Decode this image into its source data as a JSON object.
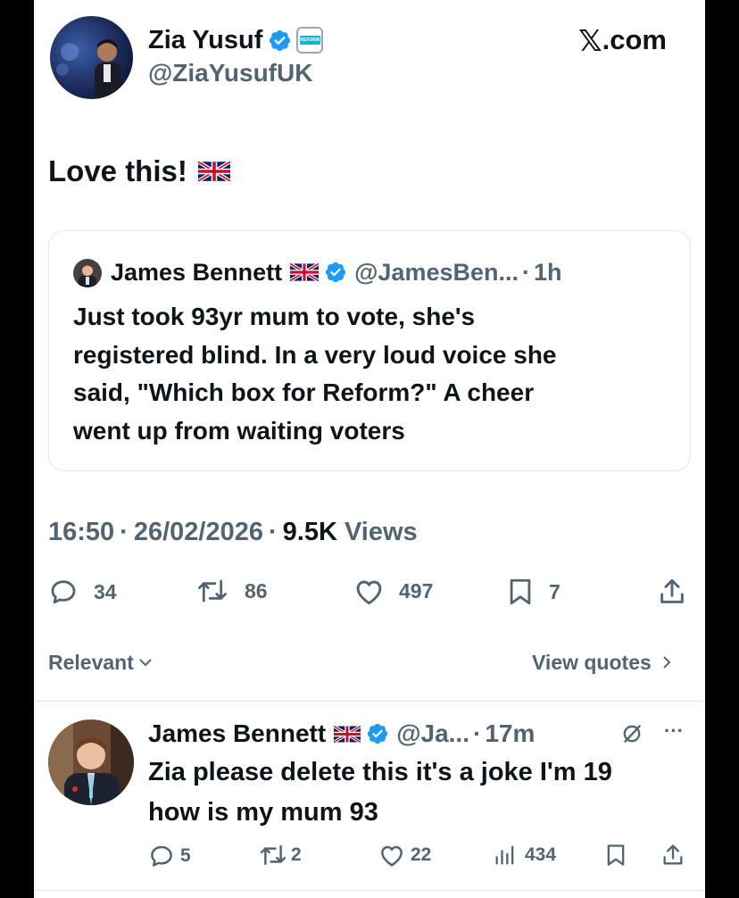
{
  "header": {
    "author_name": "Zia Yusuf",
    "author_handle": "@ZiaYusufUK",
    "affiliation_badge_text": "REFORM",
    "site_label": "X.com"
  },
  "tweet": {
    "text": "Love this!",
    "flag_icon": "uk-flag-icon"
  },
  "quoted_tweet": {
    "author_name": "James Bennett",
    "author_handle": "@JamesBen...",
    "separator": "·",
    "time": "1h",
    "text_lines": [
      "Just took 93yr mum to vote, she's",
      "registered blind. In a very loud voice she",
      "said, \"Which box for Reform?\" A cheer",
      "went up from waiting voters"
    ]
  },
  "meta": {
    "time": "16:50",
    "date": "26/02/2026",
    "sep1": "·",
    "sep2": "·",
    "views_count": "9.5K",
    "views_label": "Views"
  },
  "actions": {
    "replies": "34",
    "reposts": "86",
    "likes": "497",
    "bookmarks": "7"
  },
  "filter": {
    "sort_label": "Relevant",
    "view_quotes_label": "View quotes"
  },
  "reply": {
    "author_name": "James Bennett",
    "author_handle": "@Ja...",
    "separator": "·",
    "time": "17m",
    "more_label": "···",
    "text_lines": [
      "Zia please delete this it's a joke I'm 19",
      "how is my mum 93"
    ],
    "replies": "5",
    "reposts": "2",
    "likes": "22",
    "views": "434"
  },
  "colors": {
    "accent": "#1d9bf0",
    "muted": "#536471",
    "border": "#e1e8ed",
    "reform": "#12b6cf"
  }
}
